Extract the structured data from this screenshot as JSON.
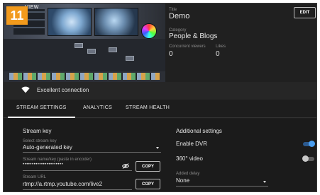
{
  "badge": "11",
  "preview": {
    "tag": "VIEW"
  },
  "stream": {
    "title_label": "Title",
    "title": "Demo",
    "category_label": "Category",
    "category": "People & Blogs",
    "viewers_label": "Concurrent viewers",
    "viewers": "0",
    "likes_label": "Likes",
    "likes": "0",
    "edit_label": "EDIT"
  },
  "connection": {
    "status": "Excellent connection"
  },
  "tabs": [
    {
      "label": "STREAM SETTINGS",
      "active": true
    },
    {
      "label": "ANALYTICS",
      "active": false
    },
    {
      "label": "STREAM HEALTH",
      "active": false
    }
  ],
  "stream_key": {
    "section_title": "Stream key",
    "select_label": "Select stream key",
    "select_value": "Auto-generated key",
    "name_label": "Stream name/key (paste in encoder)",
    "name_value": "••••••••••••••••••••••",
    "copy_label": "COPY",
    "url_label": "Stream URL",
    "url_value": "rtmp://a.rtmp.youtube.com/live2",
    "copy_label_2": "COPY"
  },
  "additional": {
    "section_title": "Additional settings",
    "dvr_label": "Enable DVR",
    "dvr_enabled": true,
    "video360_label": "360° video",
    "video360_enabled": false,
    "delay_label": "Added delay",
    "delay_value": "None"
  },
  "colors": {
    "badge": "#f29a1c",
    "toggle_on": "#4a9ff0"
  }
}
